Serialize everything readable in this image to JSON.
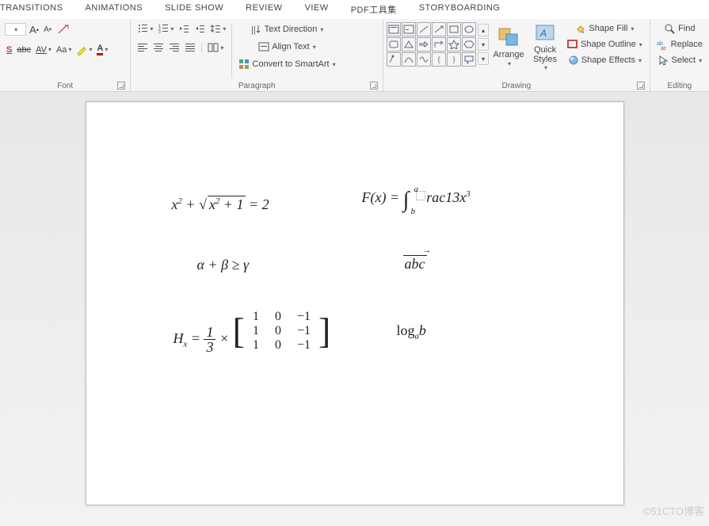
{
  "tabs": [
    "TRANSITIONS",
    "ANIMATIONS",
    "SLIDE SHOW",
    "REVIEW",
    "VIEW",
    "PDF工具集",
    "STORYBOARDING"
  ],
  "font_group": {
    "label": "Font",
    "grow": "A",
    "shrink": "A",
    "strike": "abc",
    "spacing": "AV",
    "case": "Aa",
    "fontcolor": "A"
  },
  "para_group": {
    "label": "Paragraph",
    "text_direction": "Text Direction",
    "align_text": "Align Text",
    "convert_smartart": "Convert to SmartArt"
  },
  "draw_group": {
    "label": "Drawing",
    "arrange": "Arrange",
    "quick_styles": "Quick\nStyles",
    "shape_fill": "Shape Fill",
    "shape_outline": "Shape Outline",
    "shape_effects": "Shape Effects"
  },
  "edit_group": {
    "label": "Editing",
    "find": "Find",
    "replace": "Replace",
    "select": "Select"
  },
  "slide": {
    "eq1_a": "x",
    "eq1_b": "2",
    "eq1_c": " + ",
    "eq1_d": "x",
    "eq1_e": "2",
    "eq1_f": " + 1",
    "eq1_g": " = 2",
    "eq2": "α + β ≥ γ",
    "eq3_a": "H",
    "eq3_b": "x",
    "eq3_c": " = ",
    "eq3_d": "1",
    "eq3_e": "3",
    "eq3_f": " × ",
    "eq3_m": [
      [
        "1",
        "0",
        "−1"
      ],
      [
        "1",
        "0",
        "−1"
      ],
      [
        "1",
        "0",
        "−1"
      ]
    ],
    "eq4_a": "F(x) = ",
    "eq4_b": "a",
    "eq4_c": "b",
    "eq4_d": "rac13x",
    "eq4_e": "3",
    "eq5": "abc",
    "eq6_a": "log",
    "eq6_b": "a",
    "eq6_c": "b"
  },
  "watermark": "©51CTO博客"
}
